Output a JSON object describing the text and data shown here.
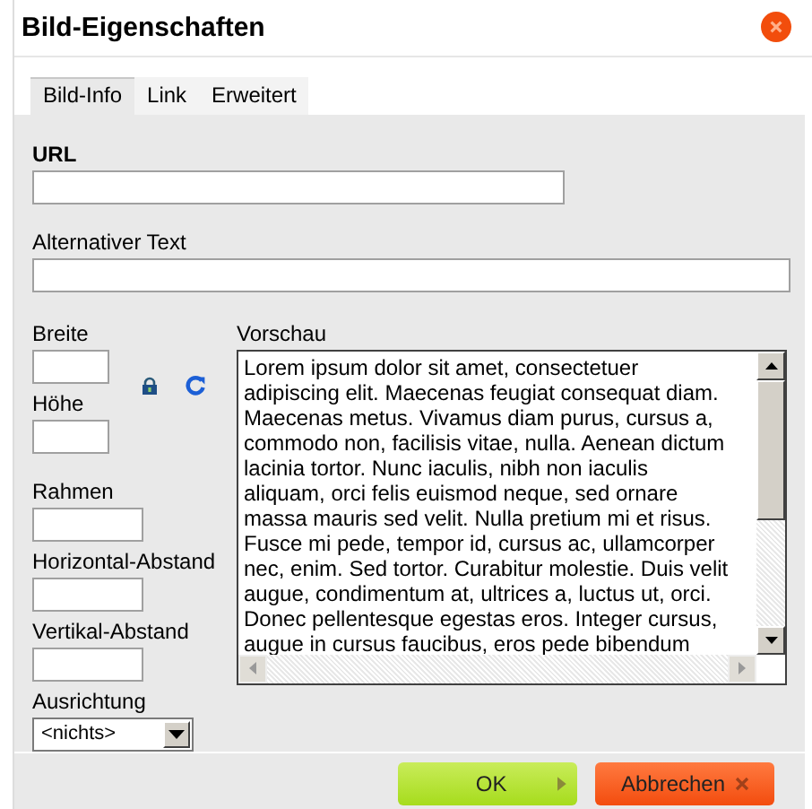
{
  "window": {
    "title": "Bild-Eigenschaften"
  },
  "tabs": [
    {
      "label": "Bild-Info",
      "selected": true
    },
    {
      "label": "Link",
      "selected": false
    },
    {
      "label": "Erweitert",
      "selected": false
    }
  ],
  "url": {
    "label": "URL"
  },
  "alt_text": {
    "label": "Alternativer Text"
  },
  "width": {
    "label": "Breite"
  },
  "height": {
    "label": "Höhe"
  },
  "border": {
    "label": "Rahmen"
  },
  "hspace": {
    "label": "Horizontal-Abstand"
  },
  "vspace": {
    "label": "Vertikal-Abstand"
  },
  "align": {
    "label": "Ausrichtung",
    "value": "<nichts>"
  },
  "preview": {
    "label": "Vorschau",
    "text": "Lorem ipsum dolor sit amet, consectetuer\nadipiscing elit. Maecenas feugiat consequat diam.\nMaecenas metus. Vivamus diam purus, cursus a,\ncommodo non, facilisis vitae, nulla. Aenean dictum\nlacinia tortor. Nunc iaculis, nibh non iaculis\naliquam, orci felis euismod neque, sed ornare\nmassa mauris sed velit. Nulla pretium mi et risus.\nFusce mi pede, tempor id, cursus ac, ullamcorper\nnec, enim. Sed tortor. Curabitur molestie. Duis velit\naugue, condimentum at, ultrices a, luctus ut, orci.\nDonec pellentesque egestas eros. Integer cursus,\naugue in cursus faucibus, eros pede bibendum"
  },
  "buttons": [
    {
      "kind": "ok",
      "label": "OK"
    },
    {
      "kind": "cancel",
      "label": "Abbrechen"
    }
  ]
}
